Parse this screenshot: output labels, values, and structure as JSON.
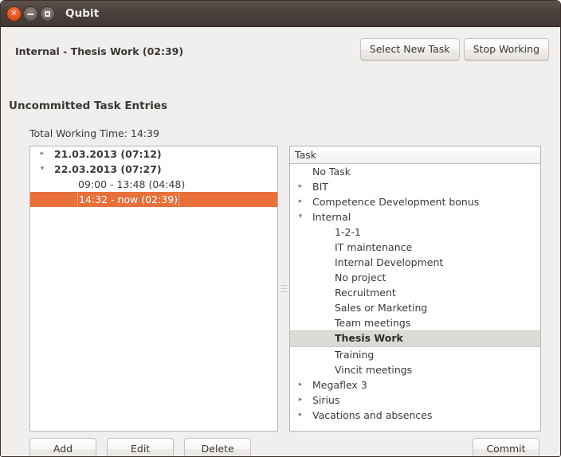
{
  "window": {
    "title": "Qubit",
    "controls": {
      "close": "close-icon",
      "minimize": "minimize-icon",
      "maximize": "maximize-icon",
      "close_glyph": "×"
    }
  },
  "header": {
    "current_task": "Internal - Thesis Work (02:39)",
    "select_new_task_label": "Select New Task",
    "stop_working_label": "Stop Working",
    "section_title": "Uncommitted Task Entries",
    "total_working_time": "Total Working Time:  14:39"
  },
  "entries_panel": {
    "rows": [
      {
        "label": "21.03.2013 (07:12)",
        "level": 0,
        "arrow": "▸",
        "bold": true,
        "selected": false
      },
      {
        "label": "22.03.2013 (07:27)",
        "level": 0,
        "arrow": "▾",
        "bold": true,
        "selected": false
      },
      {
        "label": "09:00 - 13:48 (04:48)",
        "level": 1,
        "arrow": "",
        "bold": false,
        "selected": false
      },
      {
        "label": "14:32 - now (02:39)",
        "level": 1,
        "arrow": "",
        "bold": false,
        "selected": true
      }
    ]
  },
  "task_panel": {
    "column_header": "Task",
    "rows": [
      {
        "label": "No  Task",
        "level": 0,
        "arrow": "",
        "selected": false
      },
      {
        "label": "BIT",
        "level": 0,
        "arrow": "▸",
        "selected": false
      },
      {
        "label": "Competence Development bonus",
        "level": 0,
        "arrow": "▸",
        "selected": false
      },
      {
        "label": "Internal",
        "level": 0,
        "arrow": "▾",
        "selected": false
      },
      {
        "label": "1-2-1",
        "level": 1,
        "arrow": "",
        "selected": false
      },
      {
        "label": "IT maintenance",
        "level": 1,
        "arrow": "",
        "selected": false
      },
      {
        "label": "Internal Development",
        "level": 1,
        "arrow": "",
        "selected": false
      },
      {
        "label": "No project",
        "level": 1,
        "arrow": "",
        "selected": false
      },
      {
        "label": "Recruitment",
        "level": 1,
        "arrow": "",
        "selected": false
      },
      {
        "label": "Sales or Marketing",
        "level": 1,
        "arrow": "",
        "selected": false
      },
      {
        "label": "Team meetings",
        "level": 1,
        "arrow": "",
        "selected": false
      },
      {
        "label": "Thesis Work",
        "level": 1,
        "arrow": "",
        "selected": true
      },
      {
        "label": "Training",
        "level": 1,
        "arrow": "",
        "selected": false
      },
      {
        "label": "Vincit meetings",
        "level": 1,
        "arrow": "",
        "selected": false
      },
      {
        "label": "Megaflex 3",
        "level": 0,
        "arrow": "▸",
        "selected": false
      },
      {
        "label": "Sirius",
        "level": 0,
        "arrow": "▸",
        "selected": false
      },
      {
        "label": "Vacations and absences",
        "level": 0,
        "arrow": "▸",
        "selected": false
      }
    ]
  },
  "footer": {
    "add_label": "Add",
    "edit_label": "Edit",
    "delete_label": "Delete",
    "commit_label": "Commit"
  },
  "colors": {
    "selection_orange": "#e8703a",
    "selection_gray": "#dcdad6",
    "window_bg": "#f0efee",
    "titlebar": "#4a403c"
  }
}
